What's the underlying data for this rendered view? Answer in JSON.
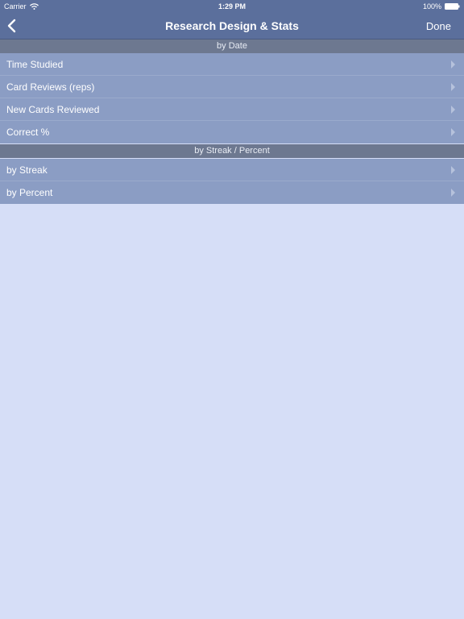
{
  "status_bar": {
    "carrier": "Carrier",
    "time": "1:29 PM",
    "battery": "100%"
  },
  "nav": {
    "back_icon": "chevron-left-icon",
    "title": "Research Design & Stats",
    "done_label": "Done"
  },
  "sections": [
    {
      "header": "by Date",
      "rows": [
        {
          "label": "Time Studied"
        },
        {
          "label": "Card Reviews (reps)"
        },
        {
          "label": "New Cards Reviewed"
        },
        {
          "label": "Correct %"
        }
      ]
    },
    {
      "header": "by Streak / Percent",
      "rows": [
        {
          "label": "by Streak"
        },
        {
          "label": "by Percent"
        }
      ]
    }
  ],
  "colors": {
    "nav_background": "#5b6f9c",
    "section_header": "#6d7890",
    "row_background": "#8b9dc4",
    "page_background": "#d6def7"
  }
}
